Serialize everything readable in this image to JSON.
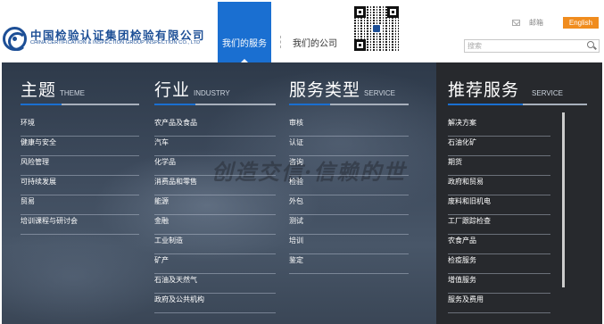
{
  "header": {
    "logo_cn": "中国检验认证集团检验有限公司",
    "logo_en": "CHINA CERTIFICATION & INSPECTION GROUP INSPECTION CO., LTD",
    "nav": [
      {
        "label": "我们的服务",
        "active": true
      },
      {
        "label": "我们的公司",
        "active": false
      }
    ],
    "mail_label": "邮箱",
    "language_label": "English",
    "search_placeholder": "搜索",
    "icons": [
      "logo-mark",
      "qr-code",
      "mail-icon",
      "search-icon"
    ]
  },
  "menu": {
    "slogan": "创造交信·信赖的世",
    "columns": [
      {
        "title_cn": "主题",
        "title_en": "THEME",
        "items": [
          "环境",
          "健康与安全",
          "风险管理",
          "可持续发展",
          "贸易",
          "培训课程与研讨会"
        ]
      },
      {
        "title_cn": "行业",
        "title_en": "INDUSTRY",
        "items": [
          "农产品及食品",
          "汽车",
          "化学品",
          "消费品和零售",
          "能源",
          "金融",
          "工业制造",
          "矿产",
          "石油及天然气",
          "政府及公共机构"
        ]
      },
      {
        "title_cn": "服务类型",
        "title_en": "SERVICE",
        "items": [
          "审核",
          "认证",
          "咨询",
          "检验",
          "外包",
          "测试",
          "培训",
          "鉴定"
        ]
      },
      {
        "title_cn": "推荐服务",
        "title_en": "SERVICE",
        "items": [
          "解决方案",
          "石油化矿",
          "期货",
          "政府和贸易",
          "废料和旧机电",
          "工厂跟踪检查",
          "农食产品",
          "检疫服务",
          "增值服务",
          "服务及费用"
        ]
      }
    ]
  },
  "colors": {
    "accent_blue": "#1a6fd1",
    "brand_blue": "#1d4f96",
    "english_orange": "#f08c1e",
    "menu_dark": "#27292d"
  }
}
